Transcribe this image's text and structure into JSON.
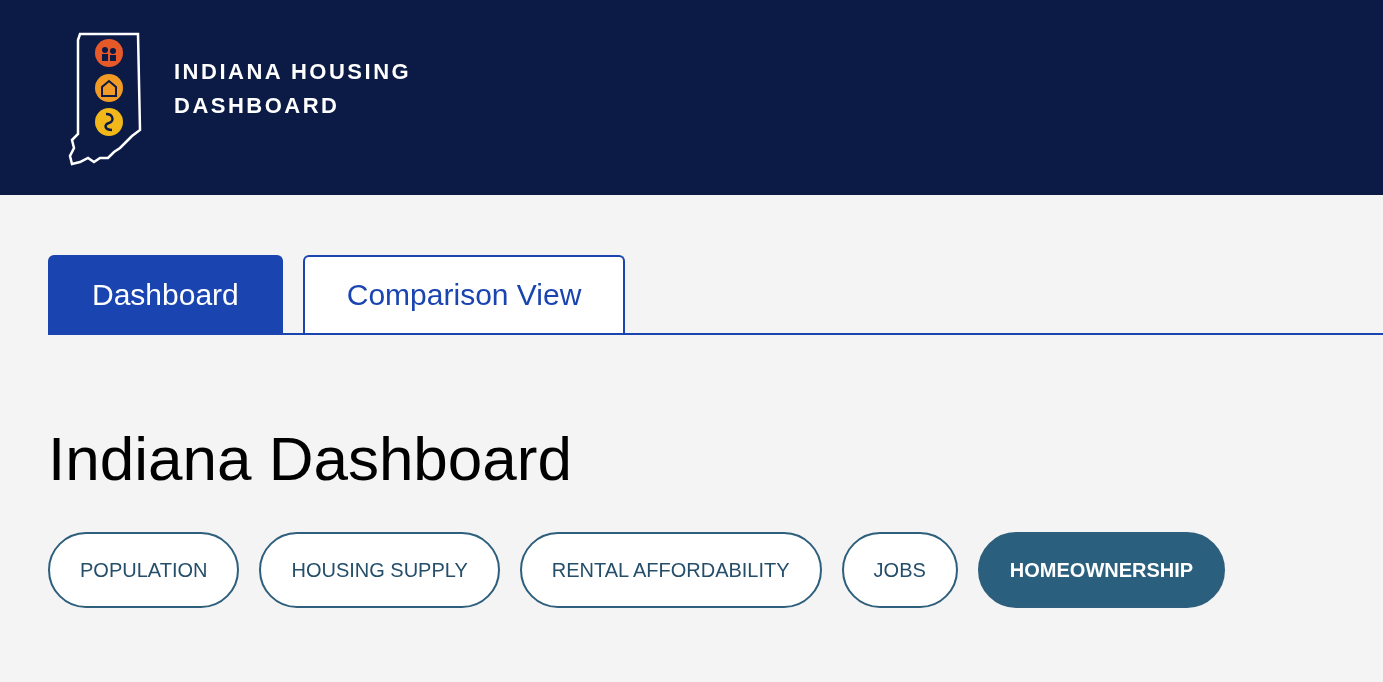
{
  "header": {
    "logo_lines": [
      "INDIANA HOUSING",
      "DASHBOARD"
    ]
  },
  "tabs": [
    {
      "label": "Dashboard",
      "selected": true
    },
    {
      "label": "Comparison View",
      "selected": false
    }
  ],
  "heading": "Indiana Dashboard",
  "topics": [
    {
      "label": "POPULATION",
      "selected": false
    },
    {
      "label": "HOUSING SUPPLY",
      "selected": false
    },
    {
      "label": "RENTAL AFFORDABILITY",
      "selected": false
    },
    {
      "label": "JOBS",
      "selected": false
    },
    {
      "label": "HOMEOWNERSHIP",
      "selected": true
    }
  ]
}
